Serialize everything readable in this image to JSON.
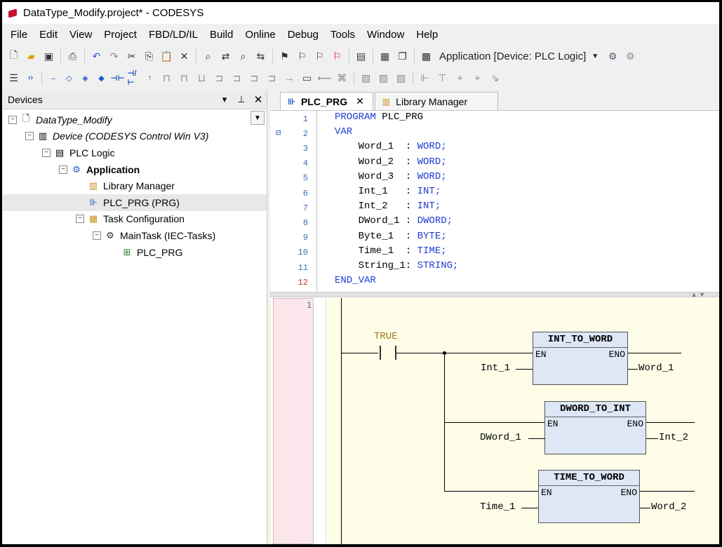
{
  "window": {
    "title": "DataType_Modify.project* - CODESYS"
  },
  "menu": [
    "File",
    "Edit",
    "View",
    "Project",
    "FBD/LD/IL",
    "Build",
    "Online",
    "Debug",
    "Tools",
    "Window",
    "Help"
  ],
  "toolbar": {
    "app_selector": "Application [Device: PLC Logic]"
  },
  "devices": {
    "title": "Devices",
    "tree": [
      {
        "label": "DataType_Modify",
        "depth": 0,
        "style": "italic",
        "expander": "−",
        "icon": "project-icon"
      },
      {
        "label": "Device (CODESYS Control Win V3)",
        "depth": 1,
        "style": "italic",
        "expander": "−",
        "icon": "device-icon"
      },
      {
        "label": "PLC Logic",
        "depth": 2,
        "style": "normal",
        "expander": "−",
        "icon": "plc-logic-icon"
      },
      {
        "label": "Application",
        "depth": 3,
        "style": "bold",
        "expander": "−",
        "icon": "gear-icon"
      },
      {
        "label": "Library Manager",
        "depth": 4,
        "style": "normal",
        "expander": "",
        "icon": "library-icon"
      },
      {
        "label": "PLC_PRG (PRG)",
        "depth": 4,
        "style": "normal",
        "expander": "",
        "icon": "program-icon",
        "selected": true
      },
      {
        "label": "Task Configuration",
        "depth": 4,
        "style": "normal",
        "expander": "−",
        "icon": "task-config-icon"
      },
      {
        "label": "MainTask (IEC-Tasks)",
        "depth": 5,
        "style": "normal",
        "expander": "−",
        "icon": "task-icon"
      },
      {
        "label": "PLC_PRG",
        "depth": 6,
        "style": "normal",
        "expander": "",
        "icon": "call-icon"
      }
    ]
  },
  "tabs": [
    {
      "label": "PLC_PRG",
      "active": true,
      "closable": true
    },
    {
      "label": "Library Manager",
      "active": false,
      "closable": false
    }
  ],
  "code": {
    "lines": [
      {
        "n": "1",
        "pre": "PROGRAM",
        "text": " PLC_PRG"
      },
      {
        "n": "2",
        "pre": "VAR",
        "text": ""
      },
      {
        "n": "3",
        "pre": "",
        "text": "    Word_1  : ",
        "type": "WORD;"
      },
      {
        "n": "4",
        "pre": "",
        "text": "    Word_2  : ",
        "type": "WORD;"
      },
      {
        "n": "5",
        "pre": "",
        "text": "    Word_3  : ",
        "type": "WORD;"
      },
      {
        "n": "6",
        "pre": "",
        "text": "    Int_1   : ",
        "type": "INT;"
      },
      {
        "n": "7",
        "pre": "",
        "text": "    Int_2   : ",
        "type": "INT;"
      },
      {
        "n": "8",
        "pre": "",
        "text": "    DWord_1 : ",
        "type": "DWORD;"
      },
      {
        "n": "9",
        "pre": "",
        "text": "    Byte_1  : ",
        "type": "BYTE;"
      },
      {
        "n": "10",
        "pre": "",
        "text": "    Time_1  : ",
        "type": "TIME;"
      },
      {
        "n": "11",
        "pre": "",
        "text": "    String_1: ",
        "type": "STRING;"
      },
      {
        "n": "12",
        "pre": "END_VAR",
        "text": ""
      }
    ]
  },
  "ladder": {
    "network_number": "1",
    "contact_label": "TRUE",
    "blocks": [
      {
        "name": "INT_TO_WORD",
        "en": "EN",
        "eno": "ENO",
        "input": "Int_1",
        "output": "Word_1"
      },
      {
        "name": "DWORD_TO_INT",
        "en": "EN",
        "eno": "ENO",
        "input": "DWord_1",
        "output": "Int_2"
      },
      {
        "name": "TIME_TO_WORD",
        "en": "EN",
        "eno": "ENO",
        "input": "Time_1",
        "output": "Word_2"
      }
    ]
  }
}
